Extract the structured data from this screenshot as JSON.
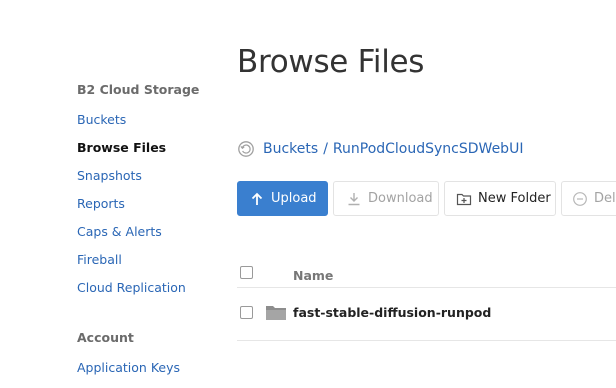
{
  "sidebar": {
    "section_storage": "B2 Cloud Storage",
    "storage_items": [
      {
        "label": "Buckets",
        "active": false
      },
      {
        "label": "Browse Files",
        "active": true
      },
      {
        "label": "Snapshots",
        "active": false
      },
      {
        "label": "Reports",
        "active": false
      },
      {
        "label": "Caps & Alerts",
        "active": false
      },
      {
        "label": "Fireball",
        "active": false
      },
      {
        "label": "Cloud Replication",
        "active": false
      }
    ],
    "section_account": "Account",
    "account_items": [
      {
        "label": "Application Keys",
        "active": false
      }
    ]
  },
  "main": {
    "title": "Browse Files",
    "breadcrumb": {
      "icon": "history-icon",
      "root": "Buckets",
      "separator": "/",
      "current": "RunPodCloudSyncSDWebUI"
    },
    "toolbar": {
      "upload": "Upload",
      "download": "Download",
      "new_folder": "New Folder",
      "delete": "Dele"
    },
    "table": {
      "column_name": "Name",
      "rows": [
        {
          "name": "fast-stable-diffusion-runpod",
          "type": "folder"
        }
      ]
    }
  },
  "colors": {
    "link": "#2a66b5",
    "primary_button": "#3a7fcf",
    "disabled_text": "#a3a3a3"
  }
}
